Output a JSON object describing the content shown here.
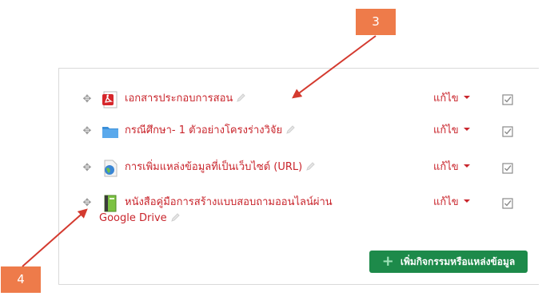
{
  "activities": [
    {
      "title": "เอกสารประกอบการสอน",
      "icon": "pdf-icon",
      "edit_label": "แก้ไข"
    },
    {
      "title": "กรณีศึกษา- 1 ตัวอย่างโครงร่างวิจัย",
      "icon": "folder-icon",
      "edit_label": "แก้ไข"
    },
    {
      "title": "การเพิ่มแหล่งข้อมูลที่เป็นเว็บไซต์ (URL)",
      "icon": "url-globe-icon",
      "edit_label": "แก้ไข"
    },
    {
      "title": "หนังสือคู่มือการสร้างแบบสอบถามออนไลน์ผ่าน",
      "title_line2": "Google Drive",
      "icon": "book-icon",
      "edit_label": "แก้ไข"
    }
  ],
  "add_button_label": "เพิ่มกิจกรรมหรือแหล่งข้อมูล",
  "callouts": {
    "top": "3",
    "bottom": "4"
  },
  "colors": {
    "link": "#c9252c",
    "button": "#1d8a4a",
    "callout": "#ee7b4a"
  }
}
